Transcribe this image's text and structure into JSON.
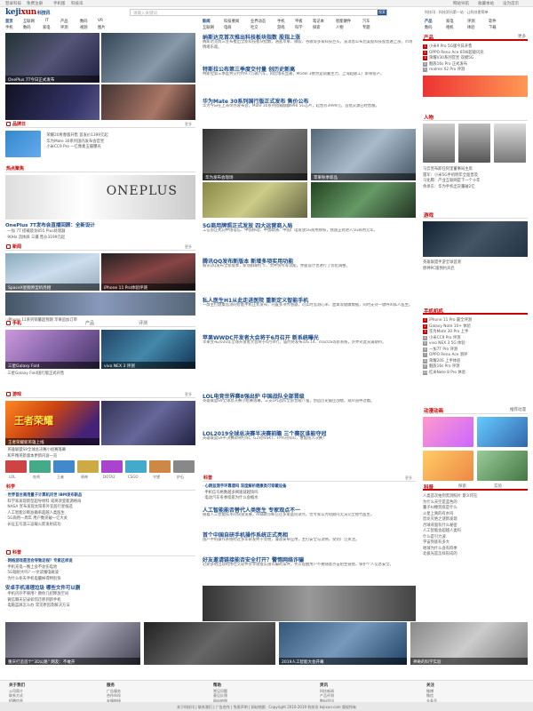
{
  "topbar": {
    "items": [
      "登录科技",
      "免费注册",
      "手机版",
      "科技讯"
    ],
    "right": [
      "网站导航",
      "收藏本站",
      "设为首页"
    ]
  },
  "header": {
    "logo_main": "keji",
    "logo_accent": "xun",
    "logo_cn": "科技讯",
    "search_placeholder": "请输入关键词",
    "search_btn": "搜索",
    "hotline": "科技讯 · 科技资讯第一站 · 让科技更简单"
  },
  "nav": {
    "left_row1": [
      "首页",
      "互联网",
      "IT",
      "产品",
      "数码",
      "VR"
    ],
    "left_row2": [
      "手机",
      "数码",
      "家电",
      "评测",
      "视频",
      "图片"
    ],
    "mid_row1": [
      "新闻",
      "科技要闻",
      "业界动态",
      "手机",
      "平板",
      "笔记本",
      "智能硬件",
      "汽车"
    ],
    "mid_row2": [
      "互联网",
      "电商",
      "社交",
      "游戏",
      "科学",
      "探索",
      "人物",
      "专题"
    ],
    "right_row1": [
      "产品",
      "家电",
      "评测",
      "软件"
    ],
    "right_row2": [
      "数码",
      "相机",
      "体验",
      "下载"
    ]
  },
  "left": {
    "hero_caption": "OnePlus 7T今日正式发布",
    "section1_title": "品牌日",
    "section1_more": "更多",
    "section1_lines": [
      "荣耀20青春版开售 首发价1399元起",
      "华为Mate 30系列国内发布会官宣",
      "小米CC9 Pro 一亿像素五摄曝光"
    ],
    "feature_title": "OnePlus 7T发布会直播回顾：全新设计",
    "feature_lines": [
      "一加 7T 搭载骁龙855 Plus处理器",
      "90Hz 流体屏 三摄 售价3199元起"
    ],
    "section2_title": "新闻",
    "section2_more": "更多",
    "news_caption1": "SpaceX星舰原型机亮相",
    "news_caption2": "iPhone 11 Pro体验评测",
    "news_lines": [
      "iPhone 11系列销量超预期 苹果追加订单"
    ],
    "section3_title": "手机",
    "section3_tabs": [
      "手机",
      "产品",
      "评测"
    ],
    "phone_captions": [
      "三星Galaxy Fold",
      "vivo NEX 3 评测"
    ],
    "phone_lines": [
      "三星Galaxy Fold国行版正式开售"
    ],
    "section4_title": "游戏",
    "section4_more": "更多",
    "game_caption": "王者荣耀新英雄上线",
    "game_lines": [
      "英雄联盟S9全球总决赛小组赛落幕",
      "和平精英新版本更新内容一览"
    ],
    "game_thumbs": [
      "LOL",
      "吃鸡",
      "王者",
      "原神",
      "DOTA2",
      "CSGO",
      "守望",
      "炉石"
    ],
    "section5_title": "科学",
    "science_lines": [
      "世界首台商用量子计算机问世 IBM发布新品",
      "科学家发现新型超导材料 或将改变能源格局",
      "NASA 宣布发现太阳系外宜居行星候选",
      "人工智能诊断准确率超越人类医生",
      "5G商用一周年 用户数突破一亿大关",
      "长征五号遥三运载火箭发射成功"
    ],
    "section6_title": "科普",
    "kepu_lines": [
      "网络游戏是否会导致近视？专家这样说",
      "手机充电一晚上会不会伤电池",
      "5G辐射大吗？一文读懂电磁波",
      "为什么冬天手机电量掉得特别快"
    ],
    "kepu_head": "安卓手机清理垃圾 哪些文件可以删",
    "kepu_lines2": [
      "手机内存不够用？教你几招释放空间",
      "微信聊天记录如何迁移到新手机",
      "电脑蓝屏怎么办 常见原因及解决方法"
    ]
  },
  "middle": {
    "headlines": [
      {
        "title": "纳斯达克首次推出科技板块指数 股指上涨",
        "desc": "纳斯达克周三宣布推出全新科技板块指数，涵盖苹果、微软、谷歌等多家科技巨头，该消息公布后美股科技股普遍上涨，市场情绪乐观。"
      },
      {
        "title": "特斯拉公布第三季度交付量 创历史新高",
        "desc": "特斯拉第三季度共交付约9.7万辆汽车，同比增长显著，Model 3依然是销量主力，上海超级工厂即将投产。"
      },
      {
        "title": "华为Mate 30系列国行版正式发布 售价公布",
        "desc": "华为今日在上海举办发布会，Mate 30系列搭载麒麟990 5G芯片，起售价3999元，首批货源已经售罄。"
      }
    ],
    "photos": [
      "华为发布会现场",
      "苹果秋季新品"
    ],
    "news2_title": "5G商用牌照正式发放 四大运营商入局",
    "news2_desc": "工信部正式向中国电信、中国移动、中国联通、中国广电发放5G商用牌照，我国正式进入5G商用元年。",
    "news3_title": "腾讯QQ发布新版本 新增多项实用功能",
    "news3_desc": "腾讯QQ发布全新版本，新增群聊打卡、文件快传等功能，界面设计也进行了优化调整。",
    "news4_title": "私人医生H1从此走进医院 重新定义智能手机",
    "news4_desc": "一款主打健康监测的智能手机正式发布，内置多项传感器，可实时监测心率、血氧等健康数据，同时支持一键呼叫私人医生。",
    "news5_title": "苹果WWDC开发者大会将于6月召开 新系统曝光",
    "news5_desc": "苹果宣布2020年全球开发者大会将于6月举行，届时将发布iOS 14、macOS等新系统，外界对此充满期待。",
    "news6_title": "LOL电竞世界赛8强出炉 中国战队全部晋级",
    "news6_desc": "英雄联盟S9全球总决赛小组赛落幕，三支LPL战队全部晋级八强，创造历史最佳战绩，观众直呼过瘾。",
    "news7_title": "LOL2019全球总决赛半决赛前瞻 三个赛区谁能夺冠",
    "news7_desc": "英雄联盟S9半决赛即将打响，G2对阵SKT、FPX对阵IG，谁能闯入决赛？",
    "section_title": "科普",
    "section_more": "更多",
    "kp_lines": [
      "心跳监测手环靠谱吗 深度解析健康类可穿戴设备",
      "手机信号格数越多网速就越快吗",
      "电动汽车冬季续航为什么会缩水"
    ],
    "kp_head2": "人工智能能否替代人类医生 专家观点不一",
    "kp_desc2": "随着人工智能技术的快速发展，AI辅助诊断已在多家医院试点，但专家认为短期内无法完全替代医生。",
    "kp_head3": "首个中国自研手机操作系统正式亮相",
    "kp_desc3": "国产手机操作系统经过多年研发终于亮相，兼容安卓应用，主打安全与流畅，受到广泛关注。",
    "kp_head4": "好友邀请链接能否安全打开？警惕网络诈骗",
    "kp_desc4": "近期多地出现利用社交软件分享链接实施诈骗的案件，警方提醒用户不要随意点击陌生链接，保护个人信息安全。"
  },
  "right": {
    "sec1_title": "产品",
    "sec1_more": "更多",
    "sec1_items": [
      "小米9 Pro 5G版今日开售",
      "OPPO Reno Ace 65W超级闪充",
      "荣耀V30系列官宣 双模5G",
      "魅族16s Pro 正式发布",
      "realme X2 Pro 评测"
    ],
    "sec2_title": "人物",
    "sec2_items": [
      "马云宣布卸任阿里董事局主席",
      "雷军：小米5G手机明年全面普及",
      "马化腾：产业互联网是下一个十年",
      "余承东：华为手机出货量破2亿"
    ],
    "sec3_title": "游戏",
    "sec3_items": [
      "英雄联盟手游全球首测",
      "原神PC版预约开启"
    ],
    "sec4_title": "手机机机",
    "sec4_items": [
      "iPhone 11 Pro 最全评测",
      "Galaxy Note 10+ 体验",
      "华为Mate 30 Pro 上手",
      "小米CC9 Pro 评测",
      "vivo NEX 3 5G 体验",
      "一加7T Pro 评测",
      "OPPO Reno Ace 测评",
      "荣耀20S 上手体验",
      "魅族16s Pro 评测",
      "红米Note 8 Pro 体验"
    ],
    "sec5_title": "动漫动画",
    "sec5_more": "推荐动漫",
    "sec6_title": "科普",
    "sec6_tabs": [
      "科普",
      "探索",
      "实验"
    ],
    "sec6_items": [
      "人类首次拍到黑洞照片 意义何在",
      "为什么天空是蓝色的",
      "量子纠缠到底是什么",
      "火星上真的有水吗",
      "恐龙灭绝之谜新发现",
      "月球背面有什么秘密",
      "人工智能会超越人类吗",
      "什么是引力波",
      "宇宙到底有多大",
      "地球为什么会有四季",
      "北极光是怎样形成的"
    ]
  },
  "banner": {
    "captions": [
      "重庆打造首个“3D公路” 网友：不敢开",
      "2019人工智能大会开幕",
      "神奇的科学实验",
      "最新科技成果展"
    ]
  },
  "footer": {
    "cols": [
      {
        "title": "关于我们",
        "items": [
          "公司简介",
          "联系方式",
          "招聘信息"
        ]
      },
      {
        "title": "服务",
        "items": [
          "广告服务",
          "合作伙伴",
          "友情链接"
        ]
      },
      {
        "title": "帮助",
        "items": [
          "常见问题",
          "意见反馈",
          "网站地图"
        ]
      },
      {
        "title": "资讯",
        "items": [
          "科技新闻",
          "产品评测",
          "数码资讯"
        ]
      },
      {
        "title": "关注",
        "items": [
          "微博",
          "微信",
          "头条号"
        ]
      }
    ],
    "links": [
      "关于科技讯",
      "联系我们",
      "广告合作",
      "免责声明",
      "网站地图"
    ],
    "copyright": "Copyright 2010-2019 科技讯 kejixun.com 版权所有"
  }
}
